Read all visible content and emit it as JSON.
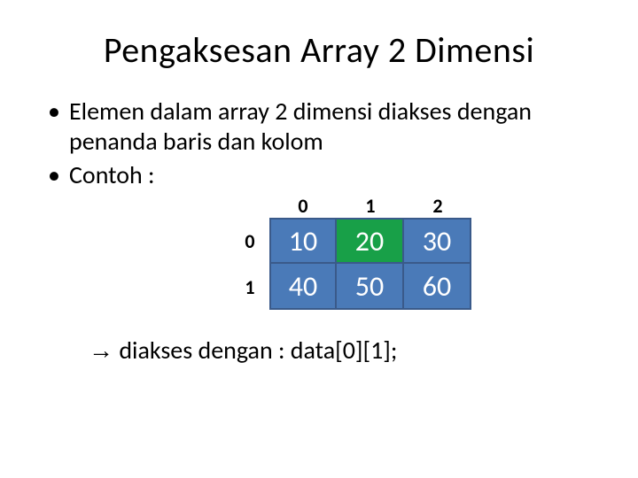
{
  "title": "Pengaksesan Array 2 Dimensi",
  "bullets": {
    "b1": "Elemen dalam array 2 dimensi diakses dengan penanda baris dan kolom",
    "b2": "Contoh :"
  },
  "table": {
    "col_headers": [
      "0",
      "1",
      "2"
    ],
    "row_headers": [
      "0",
      "1"
    ],
    "rows": [
      [
        "10",
        "20",
        "30"
      ],
      [
        "40",
        "50",
        "60"
      ]
    ],
    "highlight": {
      "row": 0,
      "col": 1
    }
  },
  "footer": {
    "arrow": "→",
    "text": " diakses dengan : data[0][1];"
  }
}
